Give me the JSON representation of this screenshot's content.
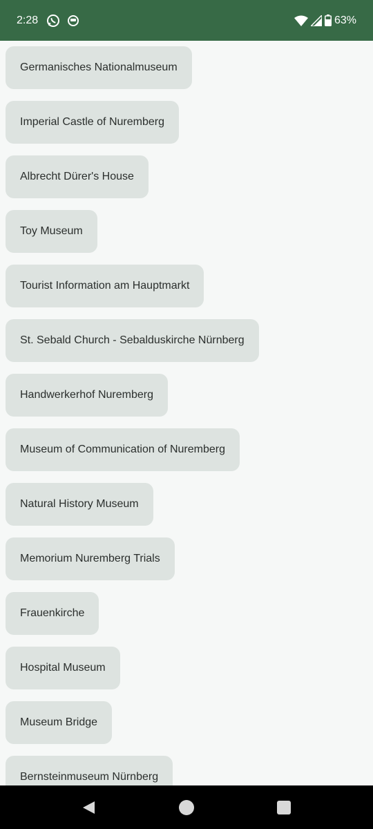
{
  "status_bar": {
    "time": "2:28",
    "battery": "63%",
    "icons": [
      "whatsapp-icon",
      "chat-bubble-icon",
      "wifi-icon",
      "signal-icon",
      "battery-icon"
    ]
  },
  "places": [
    "Germanisches Nationalmuseum",
    "Imperial Castle of Nuremberg",
    "Albrecht Dürer's House",
    "Toy Museum",
    "Tourist Information am Hauptmarkt",
    "St. Sebald Church - Sebalduskirche Nürnberg",
    "Handwerkerhof Nuremberg",
    "Museum of Communication of Nuremberg",
    "Natural History Museum",
    "Memorium Nuremberg Trials",
    "Frauenkirche",
    "Hospital Museum",
    "Museum Bridge",
    "Bernsteinmuseum Nürnberg"
  ],
  "nav_bar": {
    "icons": [
      "back-icon",
      "home-icon",
      "recents-icon"
    ]
  },
  "colors": {
    "status_bar_bg": "#376a46",
    "chip_bg": "#dde3e0",
    "page_bg": "#f6f8f7"
  }
}
